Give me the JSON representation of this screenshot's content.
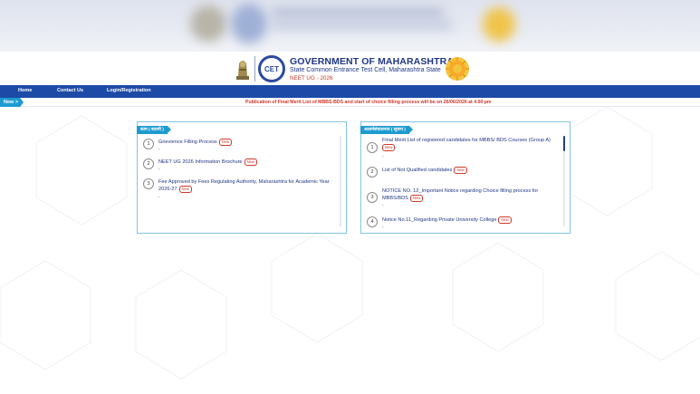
{
  "header": {
    "title": "GOVERNMENT OF MAHARASHTRA",
    "subtitle": "State Common Entrance Test Cell, Maharashtra State",
    "exam": "NEET UG - 2026",
    "logo_text": "CET"
  },
  "nav": {
    "items": [
      "Home",
      "Contact Us",
      "Login/Registration"
    ]
  },
  "ticker": {
    "label": "New >",
    "text": "Publication of Final Merit List of MBBS-BDS and start of choice filling process will be on 26/06/2026 at 4.00 pm"
  },
  "badge_label": "New",
  "left_panel": {
    "tag": "काम ( बातमी )",
    "items": [
      {
        "num": "1",
        "title": "Grievience Filling Process"
      },
      {
        "num": "2",
        "title": "NEET UG 2026 Information Brochure"
      },
      {
        "num": "3",
        "title": "Fee Approved by Fees Regulating Authority, Maharashtra for Academic Year 2026-27"
      }
    ]
  },
  "right_panel": {
    "tag": "अलार्मसंचालनाय ( सूचना )",
    "items": [
      {
        "num": "1",
        "title": "Final Merit List of registered candidates for MBBS/ BDS Courses (Group A)"
      },
      {
        "num": "2",
        "title": "List of Not Qualified candidates"
      },
      {
        "num": "3",
        "title": "NOTICE NO. 12_Important Notice regarding Choice filling process for MBBS/BDS"
      },
      {
        "num": "4",
        "title": "Notice No.11_Regarding Private University College"
      }
    ]
  },
  "colors": {
    "nav_bg": "#1d4aa7",
    "accent": "#1d9bd1",
    "ticker_text": "#d0382b",
    "title": "#1f3685"
  }
}
